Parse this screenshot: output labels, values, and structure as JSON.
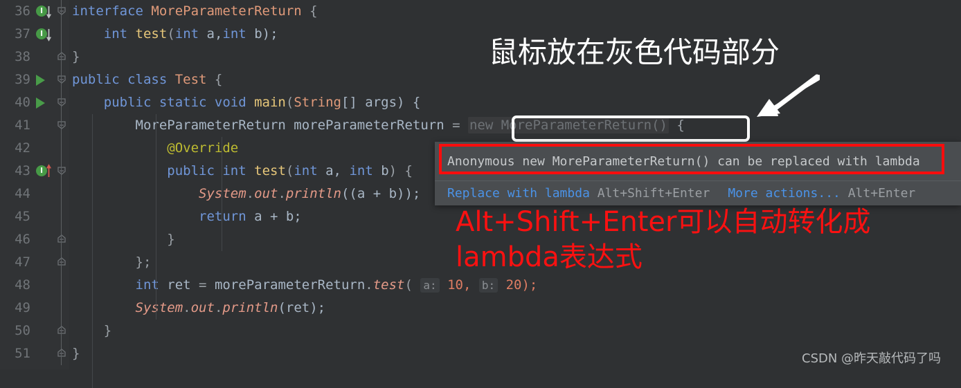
{
  "editor": {
    "background": "#2f3133",
    "gutter_background": "#313335",
    "first_line": 36,
    "change_marker_color": "#2b4a6b",
    "lines": [
      {
        "number": "36",
        "gutter_icon": "implemented-by-icon",
        "fold": "fold-open-icon",
        "tokens": [
          {
            "t": "interface ",
            "c": "kw"
          },
          {
            "t": "MoreParameterReturn",
            "c": "cls"
          },
          {
            "t": " {",
            "c": "punct"
          }
        ]
      },
      {
        "number": "37",
        "gutter_icon": "implemented-by-icon",
        "fold": "",
        "tokens": [
          {
            "t": "    ",
            "c": "plain"
          },
          {
            "t": "int",
            "c": "kw"
          },
          {
            "t": " ",
            "c": "plain"
          },
          {
            "t": "test",
            "c": "method"
          },
          {
            "t": "(",
            "c": "punct"
          },
          {
            "t": "int",
            "c": "kw"
          },
          {
            "t": " a,",
            "c": "ident"
          },
          {
            "t": "int",
            "c": "kw"
          },
          {
            "t": " b);",
            "c": "ident"
          }
        ]
      },
      {
        "number": "38",
        "gutter_icon": "",
        "fold": "fold-end-icon",
        "changed": true,
        "tokens": [
          {
            "t": "}",
            "c": "punct"
          }
        ]
      },
      {
        "number": "39",
        "gutter_icon": "run-icon",
        "fold": "fold-open-icon",
        "tokens": [
          {
            "t": "public class ",
            "c": "kw"
          },
          {
            "t": "Test",
            "c": "cls"
          },
          {
            "t": " {",
            "c": "punct"
          }
        ]
      },
      {
        "number": "40",
        "gutter_icon": "run-icon",
        "fold": "fold-open-icon",
        "tokens": [
          {
            "t": "    ",
            "c": "plain"
          },
          {
            "t": "public static void ",
            "c": "kw"
          },
          {
            "t": "main",
            "c": "method"
          },
          {
            "t": "(",
            "c": "punct"
          },
          {
            "t": "String",
            "c": "cls"
          },
          {
            "t": "[] args) {",
            "c": "ident"
          }
        ]
      },
      {
        "number": "41",
        "gutter_icon": "",
        "fold": "fold-open-icon",
        "tokens": [
          {
            "t": "        ",
            "c": "plain"
          },
          {
            "t": "MoreParameterReturn",
            "c": "ident"
          },
          {
            "t": " moreParameterReturn ",
            "c": "ident"
          },
          {
            "t": "=",
            "c": "punct"
          }
        ],
        "greyed_expression": "new MoreParameterReturn()",
        "tail_tokens": [
          {
            "t": " {",
            "c": "punct"
          }
        ]
      },
      {
        "number": "42",
        "gutter_icon": "",
        "fold": "",
        "tokens": [
          {
            "t": "            ",
            "c": "plain"
          },
          {
            "t": "@Override",
            "c": "anno"
          }
        ]
      },
      {
        "number": "43",
        "gutter_icon": "overrides-icon",
        "fold": "fold-open-icon",
        "tokens": [
          {
            "t": "            ",
            "c": "plain"
          },
          {
            "t": "public int ",
            "c": "kw"
          },
          {
            "t": "test",
            "c": "method"
          },
          {
            "t": "(",
            "c": "punct"
          },
          {
            "t": "int",
            "c": "kw"
          },
          {
            "t": " a, ",
            "c": "ident"
          },
          {
            "t": "int",
            "c": "kw"
          },
          {
            "t": " b",
            "c": "ident"
          },
          {
            "t": ") {",
            "c": "punct"
          }
        ]
      },
      {
        "number": "44",
        "gutter_icon": "",
        "fold": "",
        "tokens": [
          {
            "t": "                ",
            "c": "plain"
          },
          {
            "t": "System",
            "c": "field"
          },
          {
            "t": ".",
            "c": "punct"
          },
          {
            "t": "out",
            "c": "field"
          },
          {
            "t": ".",
            "c": "punct"
          },
          {
            "t": "println",
            "c": "field"
          },
          {
            "t": "((a + b));",
            "c": "ident"
          }
        ]
      },
      {
        "number": "45",
        "gutter_icon": "",
        "fold": "",
        "tokens": [
          {
            "t": "                ",
            "c": "plain"
          },
          {
            "t": "return",
            "c": "kw"
          },
          {
            "t": " a + b;",
            "c": "ident"
          }
        ]
      },
      {
        "number": "46",
        "gutter_icon": "",
        "fold": "fold-end-icon",
        "tokens": [
          {
            "t": "            }",
            "c": "punct"
          }
        ]
      },
      {
        "number": "47",
        "gutter_icon": "",
        "fold": "fold-end-icon",
        "tokens": [
          {
            "t": "        };",
            "c": "punct"
          }
        ]
      },
      {
        "number": "48",
        "gutter_icon": "",
        "fold": "",
        "tokens": [
          {
            "t": "        ",
            "c": "plain"
          },
          {
            "t": "int",
            "c": "kw"
          },
          {
            "t": " ret ",
            "c": "ident"
          },
          {
            "t": "=",
            "c": "punct"
          },
          {
            "t": " moreParameterReturn",
            "c": "ident"
          },
          {
            "t": ".",
            "c": "punct"
          },
          {
            "t": "test",
            "c": "field"
          },
          {
            "t": "(",
            "c": "punct"
          }
        ],
        "param_hints": [
          {
            "label": "a:",
            "value": "10,"
          },
          {
            "label": "b:",
            "value": "20);"
          }
        ]
      },
      {
        "number": "49",
        "gutter_icon": "",
        "fold": "",
        "tokens": [
          {
            "t": "        ",
            "c": "plain"
          },
          {
            "t": "System",
            "c": "field"
          },
          {
            "t": ".",
            "c": "punct"
          },
          {
            "t": "out",
            "c": "field"
          },
          {
            "t": ".",
            "c": "punct"
          },
          {
            "t": "println",
            "c": "field"
          },
          {
            "t": "(ret);",
            "c": "ident"
          }
        ]
      },
      {
        "number": "50",
        "gutter_icon": "",
        "fold": "fold-end-icon",
        "tokens": [
          {
            "t": "    }",
            "c": "punct"
          }
        ]
      },
      {
        "number": "51",
        "gutter_icon": "",
        "fold": "fold-end-icon",
        "tokens": [
          {
            "t": "}",
            "c": "punct"
          }
        ]
      }
    ]
  },
  "highlight_box": {
    "expression": "new MoreParameterReturn()",
    "border_color": "#ffffff"
  },
  "popup": {
    "message": "Anonymous new MoreParameterReturn() can be replaced with lambda",
    "message_border_color": "#fb0d0d",
    "actions": [
      {
        "label": "Replace with lambda",
        "shortcut": "Alt+Shift+Enter"
      },
      {
        "label": "More actions...",
        "shortcut": "Alt+Enter"
      }
    ],
    "background": "#4a4d50",
    "link_color": "#4b93e8"
  },
  "annotations": {
    "white_note": "鼠标放在灰色代码部分",
    "white_arrow": "arrow-down-left-icon",
    "red_note_line1": "Alt+Shift+Enter可以自动转化成",
    "red_note_line2": "lambda表达式",
    "red_color": "#fb1111"
  },
  "watermark": "CSDN @昨天敲代码了吗"
}
